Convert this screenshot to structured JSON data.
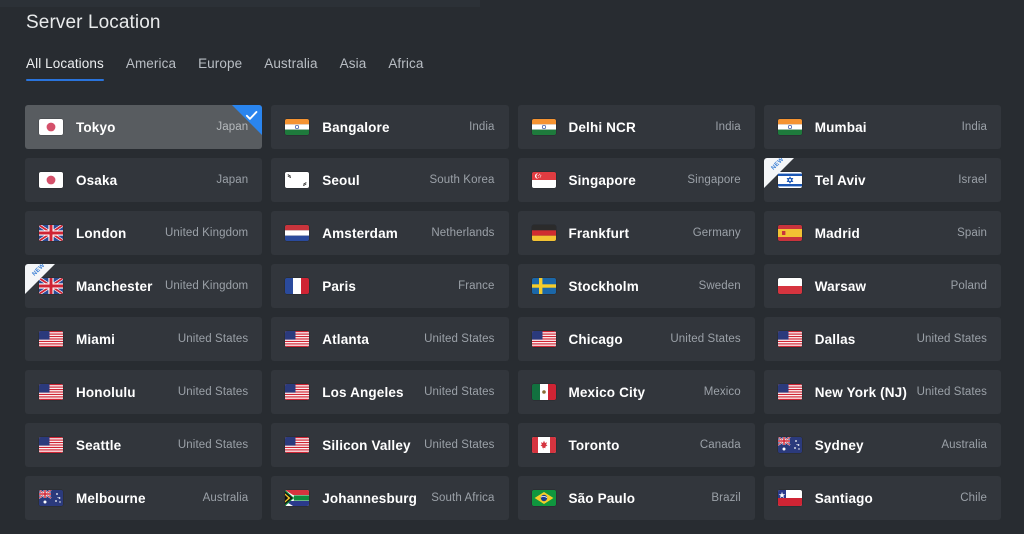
{
  "header": {
    "title": "Server Location"
  },
  "tabs": {
    "active_index": 0,
    "items": [
      {
        "label": "All Locations"
      },
      {
        "label": "America"
      },
      {
        "label": "Europe"
      },
      {
        "label": "Australia"
      },
      {
        "label": "Asia"
      },
      {
        "label": "Africa"
      }
    ]
  },
  "colors": {
    "page_bg": "#282c31",
    "card_bg": "#32363c",
    "card_selected_bg": "#585c60",
    "accent_blue": "#2a74dc",
    "check_corner_blue": "#2a85ef",
    "city_text": "#ffffff",
    "country_text": "#9ba1a8",
    "new_ribbon_bg": "#f4f6f8",
    "new_ribbon_text": "#3b7fd4"
  },
  "badges": {
    "new_label": "NEW",
    "selected_icon": "check-icon"
  },
  "locations": [
    {
      "city": "Tokyo",
      "country": "Japan",
      "flag": "jp",
      "selected": true,
      "isNew": false
    },
    {
      "city": "Bangalore",
      "country": "India",
      "flag": "in",
      "selected": false,
      "isNew": false
    },
    {
      "city": "Delhi NCR",
      "country": "India",
      "flag": "in",
      "selected": false,
      "isNew": false
    },
    {
      "city": "Mumbai",
      "country": "India",
      "flag": "in",
      "selected": false,
      "isNew": false
    },
    {
      "city": "Osaka",
      "country": "Japan",
      "flag": "jp",
      "selected": false,
      "isNew": false
    },
    {
      "city": "Seoul",
      "country": "South Korea",
      "flag": "kr",
      "selected": false,
      "isNew": false
    },
    {
      "city": "Singapore",
      "country": "Singapore",
      "flag": "sg",
      "selected": false,
      "isNew": false
    },
    {
      "city": "Tel Aviv",
      "country": "Israel",
      "flag": "il",
      "selected": false,
      "isNew": true
    },
    {
      "city": "London",
      "country": "United Kingdom",
      "flag": "gb",
      "selected": false,
      "isNew": false
    },
    {
      "city": "Amsterdam",
      "country": "Netherlands",
      "flag": "nl",
      "selected": false,
      "isNew": false
    },
    {
      "city": "Frankfurt",
      "country": "Germany",
      "flag": "de",
      "selected": false,
      "isNew": false
    },
    {
      "city": "Madrid",
      "country": "Spain",
      "flag": "es",
      "selected": false,
      "isNew": false
    },
    {
      "city": "Manchester",
      "country": "United Kingdom",
      "flag": "gb",
      "selected": false,
      "isNew": true
    },
    {
      "city": "Paris",
      "country": "France",
      "flag": "fr",
      "selected": false,
      "isNew": false
    },
    {
      "city": "Stockholm",
      "country": "Sweden",
      "flag": "se",
      "selected": false,
      "isNew": false
    },
    {
      "city": "Warsaw",
      "country": "Poland",
      "flag": "pl",
      "selected": false,
      "isNew": false
    },
    {
      "city": "Miami",
      "country": "United States",
      "flag": "us",
      "selected": false,
      "isNew": false
    },
    {
      "city": "Atlanta",
      "country": "United States",
      "flag": "us",
      "selected": false,
      "isNew": false
    },
    {
      "city": "Chicago",
      "country": "United States",
      "flag": "us",
      "selected": false,
      "isNew": false
    },
    {
      "city": "Dallas",
      "country": "United States",
      "flag": "us",
      "selected": false,
      "isNew": false
    },
    {
      "city": "Honolulu",
      "country": "United States",
      "flag": "us",
      "selected": false,
      "isNew": false
    },
    {
      "city": "Los Angeles",
      "country": "United States",
      "flag": "us",
      "selected": false,
      "isNew": false
    },
    {
      "city": "Mexico City",
      "country": "Mexico",
      "flag": "mx",
      "selected": false,
      "isNew": false
    },
    {
      "city": "New York (NJ)",
      "country": "United States",
      "flag": "us",
      "selected": false,
      "isNew": false
    },
    {
      "city": "Seattle",
      "country": "United States",
      "flag": "us",
      "selected": false,
      "isNew": false
    },
    {
      "city": "Silicon Valley",
      "country": "United States",
      "flag": "us",
      "selected": false,
      "isNew": false
    },
    {
      "city": "Toronto",
      "country": "Canada",
      "flag": "ca",
      "selected": false,
      "isNew": false
    },
    {
      "city": "Sydney",
      "country": "Australia",
      "flag": "au",
      "selected": false,
      "isNew": false
    },
    {
      "city": "Melbourne",
      "country": "Australia",
      "flag": "au",
      "selected": false,
      "isNew": false
    },
    {
      "city": "Johannesburg",
      "country": "South Africa",
      "flag": "za",
      "selected": false,
      "isNew": false
    },
    {
      "city": "São Paulo",
      "country": "Brazil",
      "flag": "br",
      "selected": false,
      "isNew": false
    },
    {
      "city": "Santiago",
      "country": "Chile",
      "flag": "cl",
      "selected": false,
      "isNew": false
    }
  ]
}
